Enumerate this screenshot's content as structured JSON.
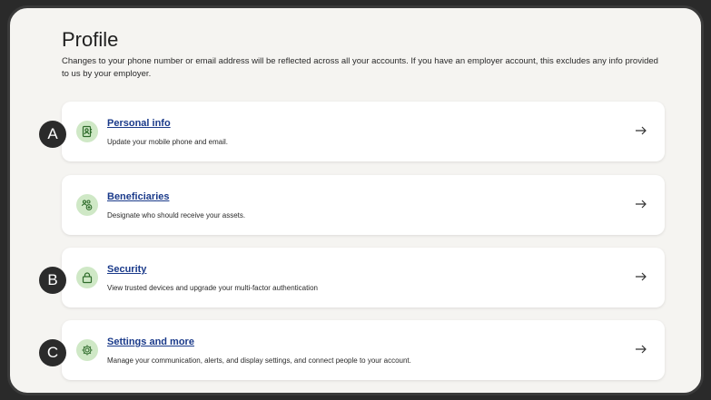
{
  "page": {
    "title": "Profile",
    "subtitle": "Changes to your phone number or email address will be reflected across all your accounts. If you have an employer account, this excludes any info provided to us by your employer."
  },
  "cards": [
    {
      "title": "Personal info",
      "description": "Update your mobile phone and email.",
      "icon": "contact-card-icon"
    },
    {
      "title": "Beneficiaries",
      "description": "Designate who should receive your assets.",
      "icon": "people-add-icon"
    },
    {
      "title": "Security",
      "description": "View trusted devices and upgrade your multi-factor authentication",
      "icon": "lock-icon"
    },
    {
      "title": "Settings and more",
      "description": "Manage your communication, alerts, and display settings, and connect people to your account.",
      "icon": "gear-icon"
    }
  ],
  "markers": [
    "A",
    "B",
    "C"
  ],
  "colors": {
    "link": "#1a3a8a",
    "icon_bg": "#cfe8c6",
    "icon_fg": "#2e6b2a",
    "marker": "#2b2b2b"
  }
}
